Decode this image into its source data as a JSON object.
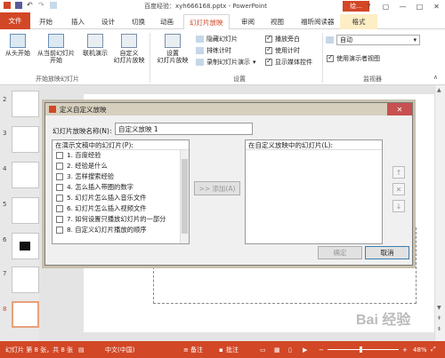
{
  "window": {
    "doc_title": "百度经验：xyh666168.pptx - PowerPoint",
    "help_label": "绘...",
    "controls": [
      "?",
      "▢",
      "—",
      "□",
      "✕"
    ]
  },
  "tabs": [
    "文件",
    "开始",
    "插入",
    "设计",
    "切换",
    "动画",
    "幻灯片放映",
    "审阅",
    "视图",
    "福昕阅读器",
    "格式"
  ],
  "ribbon": {
    "group_start": {
      "label": "开始放映幻灯片",
      "btn_from_start": "从头开始",
      "btn_from_current": "从当前幻灯片\n开始",
      "btn_online": "联机演示",
      "btn_custom": "自定义\n幻灯片放映"
    },
    "group_setup": {
      "label": "设置",
      "btn_setup": "设置\n幻灯片放映",
      "hide_slide": "隐藏幻灯片",
      "rehearse": "排练计时",
      "record": "录制幻灯片演示",
      "play_narration": "播放旁白",
      "use_timings": "使用计时",
      "show_media": "显示媒体控件"
    },
    "group_monitor": {
      "label": "监视器",
      "monitor_value": "自动",
      "presenter_view": "使用演示者视图"
    }
  },
  "slides": [
    {
      "num": "2"
    },
    {
      "num": "3"
    },
    {
      "num": "4"
    },
    {
      "num": "5"
    },
    {
      "num": "6"
    },
    {
      "num": "7"
    },
    {
      "num": "8"
    }
  ],
  "status": {
    "slide_info": "幻灯片 第 8 张，共 8 张",
    "lang": "中文(中国)",
    "notes": "备注",
    "comments": "批注",
    "zoom": "48%"
  },
  "dialog": {
    "title": "定义自定义放映",
    "close": "✕",
    "name_label": "幻灯片放映名称(N):",
    "name_value": "自定义放映 1",
    "left_header": "在演示文稿中的幻灯片(P):",
    "right_header": "在自定义放映中的幻灯片(L):",
    "items": [
      "1. 百度经验",
      "2. 经验是什么",
      "3. 怎样搜索经验",
      "4. 怎么插入带圈的数字",
      "5. 幻灯片怎么插入音乐文件",
      "6. 幻灯片怎么插入视频文件",
      "7. 如何设置只播放幻灯片的一部分",
      "8. 自定义幻灯片播放的顺序"
    ],
    "add_button": ">> 添加(A)",
    "ok_button": "确定",
    "cancel_button": "取消"
  },
  "watermark": "Bai 经验"
}
